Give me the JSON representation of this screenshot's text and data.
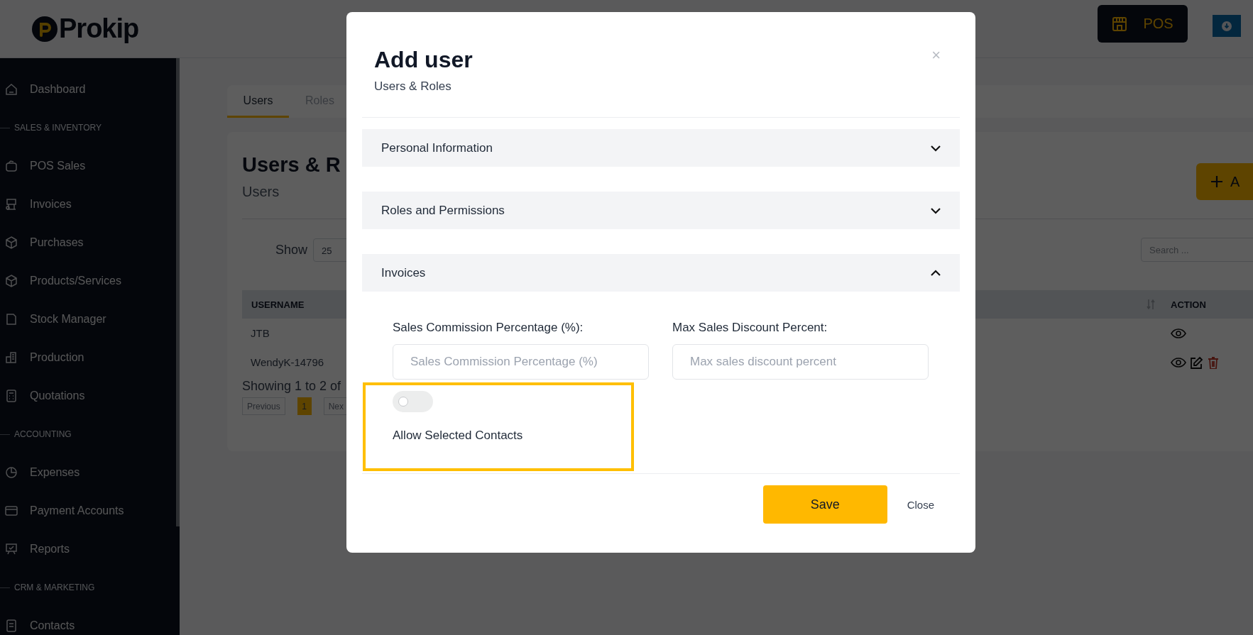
{
  "header": {
    "logo": "Prokip",
    "pos_button": "POS"
  },
  "sidebar": {
    "items": [
      {
        "kind": "link",
        "label": "Dashboard"
      },
      {
        "kind": "section",
        "label": "SALES & INVENTORY"
      },
      {
        "kind": "link",
        "label": "POS Sales"
      },
      {
        "kind": "link",
        "label": "Invoices"
      },
      {
        "kind": "link",
        "label": "Purchases"
      },
      {
        "kind": "link",
        "label": "Products/Services"
      },
      {
        "kind": "link",
        "label": "Stock Manager"
      },
      {
        "kind": "link",
        "label": "Production"
      },
      {
        "kind": "link",
        "label": "Quotations"
      },
      {
        "kind": "section",
        "label": "ACCOUNTING"
      },
      {
        "kind": "link",
        "label": "Expenses"
      },
      {
        "kind": "link",
        "label": "Payment Accounts"
      },
      {
        "kind": "link",
        "label": "Reports"
      },
      {
        "kind": "section",
        "label": "CRM & MARKETING"
      },
      {
        "kind": "link",
        "label": "Contacts"
      }
    ]
  },
  "tabs": [
    {
      "label": "Users",
      "selected": true
    },
    {
      "label": "Roles",
      "selected": false
    }
  ],
  "page": {
    "title": "Users & R",
    "subtitle": "Users",
    "add_button": "A",
    "show_label": "Show",
    "page_size": "25",
    "search": {
      "placeholder": "Search ..."
    }
  },
  "table": {
    "columns": [
      "USERNAME",
      "ACTION"
    ],
    "rows": [
      {
        "username": "JTB",
        "editable": false,
        "deletable": false
      },
      {
        "username": "WendyK-14796",
        "editable": true,
        "deletable": true
      }
    ]
  },
  "pagination": {
    "summary": "Showing 1 to 2 of",
    "previous": "Previous",
    "pages": [
      {
        "label": "1",
        "selected": true
      }
    ],
    "next": "Nex"
  },
  "modal": {
    "title": "Add user",
    "subtitle": "Users & Roles",
    "close": "×",
    "sections": [
      {
        "title": "Personal Information",
        "expanded": false
      },
      {
        "title": "Roles and Permissions",
        "expanded": false
      },
      {
        "title": "Invoices",
        "expanded": true,
        "fields": [
          {
            "label": "Sales Commission Percentage (%):",
            "placeholder": "Sales Commission Percentage (%)"
          },
          {
            "label": "Max Sales Discount Percent:",
            "placeholder": "Max sales discount percent"
          }
        ],
        "toggle": {
          "label": "Allow Selected Contacts",
          "on": false
        }
      }
    ],
    "save_button": "Save",
    "close_button": "Close"
  }
}
